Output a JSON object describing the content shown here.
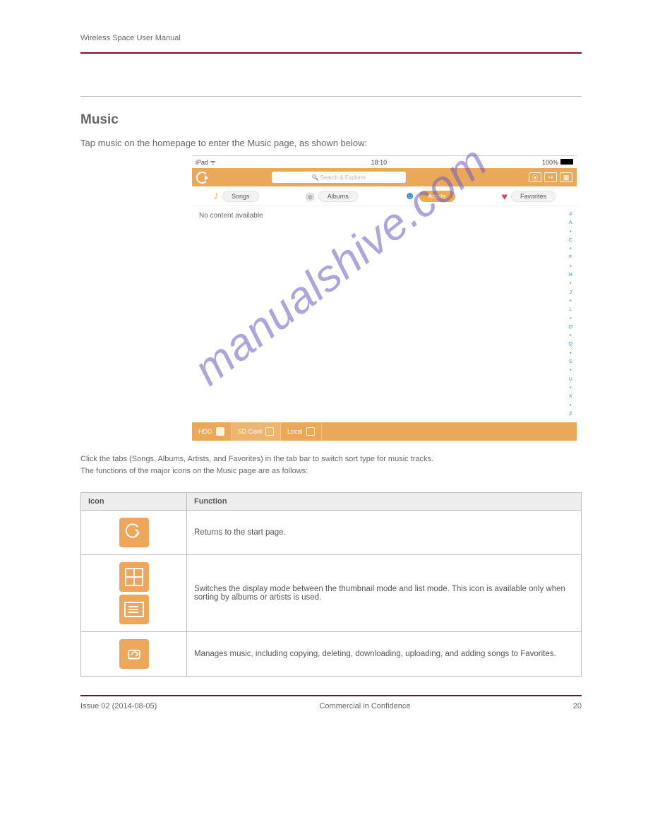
{
  "header": {
    "doc_title": "Wireless Space User Manual"
  },
  "section": {
    "title": "Music",
    "sub": "Tap music on the homepage to enter the Music page, as shown below:"
  },
  "screenshot": {
    "status": {
      "carrier": "iPad",
      "wifi": "wifi",
      "time": "18:10",
      "battery": "100%"
    },
    "search_placeholder": "Search & Explorer",
    "tabs": {
      "songs": "Songs",
      "albums": "Albums",
      "artists": "Artists",
      "favorites": "Favorites"
    },
    "content_empty": "No content available",
    "alpha": [
      "#",
      "A",
      "•",
      "C",
      "•",
      "F",
      "•",
      "H",
      "•",
      "J",
      "•",
      "L",
      "•",
      "O",
      "•",
      "Q",
      "•",
      "S",
      "•",
      "U",
      "•",
      "X",
      "•",
      "Z"
    ],
    "storage": {
      "hdd": "HDD",
      "sd": "SD Card",
      "local": "Local"
    }
  },
  "note_after": "Click the tabs (Songs, Albums, Artists, and Favorites) in the tab bar to switch sort type for music tracks.\nThe functions of the major icons on the Music page are as follows:",
  "table": {
    "head_icon": "Icon",
    "head_func": "Function",
    "rows": [
      {
        "icon": "back",
        "func": "Returns to the start page."
      },
      {
        "icon": "gridlist",
        "func": "Switches the display mode between the thumbnail mode and list mode. This icon is available only when sorting by albums or artists is used."
      },
      {
        "icon": "share",
        "func": "Manages music, including copying, deleting, downloading, uploading, and adding songs to Favorites."
      }
    ]
  },
  "watermark": "manualshive.com",
  "footer": {
    "issue": "Issue 02 (2014-08-05)",
    "copyright": "Commercial in Confidence",
    "page": "20"
  }
}
